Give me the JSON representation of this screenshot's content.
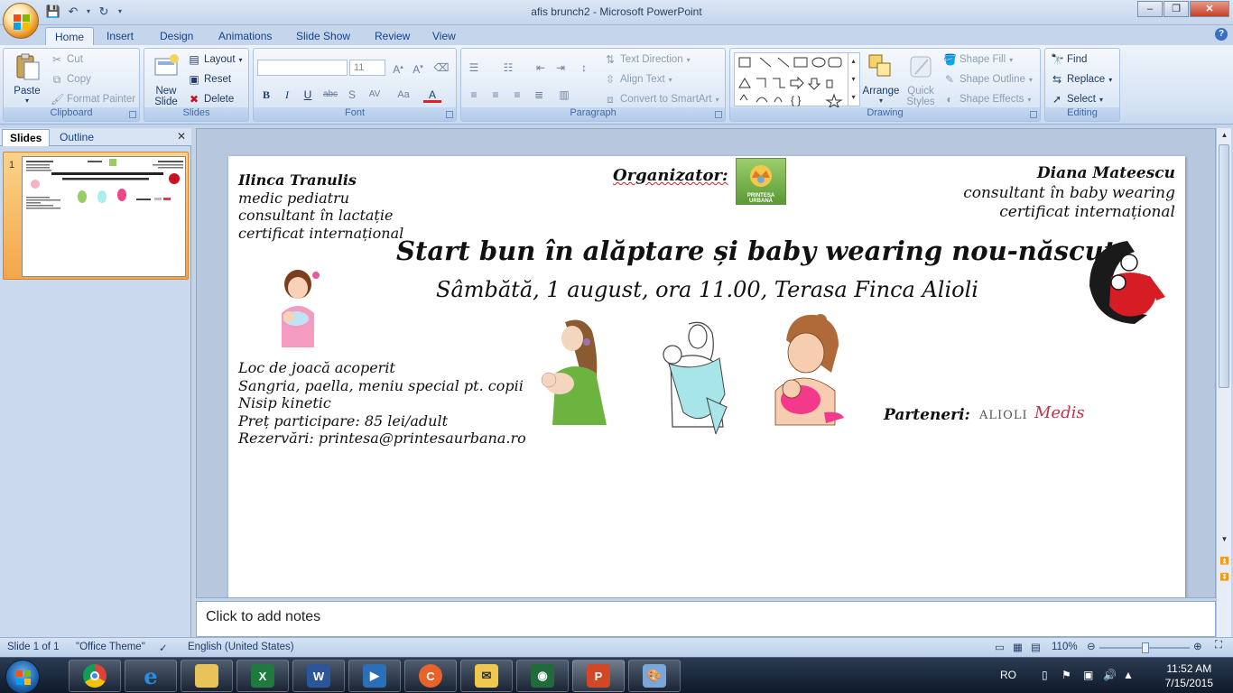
{
  "window": {
    "title": "afis brunch2 - Microsoft PowerPoint",
    "controls": [
      "minimize",
      "restore",
      "close"
    ]
  },
  "ribbon_tabs": [
    "Home",
    "Insert",
    "Design",
    "Animations",
    "Slide Show",
    "Review",
    "View"
  ],
  "ribbon": {
    "clipboard": {
      "label": "Clipboard",
      "paste": "Paste",
      "cut": "Cut",
      "copy": "Copy",
      "format_painter": "Format Painter"
    },
    "slides": {
      "label": "Slides",
      "new_slide": "New Slide",
      "layout": "Layout",
      "reset": "Reset",
      "delete": "Delete"
    },
    "font": {
      "label": "Font",
      "font_name": "",
      "font_size": "11"
    },
    "paragraph": {
      "label": "Paragraph",
      "text_direction": "Text Direction",
      "align_text": "Align Text",
      "convert_smartart": "Convert to SmartArt"
    },
    "drawing": {
      "label": "Drawing",
      "arrange": "Arrange",
      "quick_styles": "Quick Styles",
      "shape_fill": "Shape Fill",
      "shape_outline": "Shape Outline",
      "shape_effects": "Shape Effects"
    },
    "editing": {
      "label": "Editing",
      "find": "Find",
      "replace": "Replace",
      "select": "Select"
    }
  },
  "panel": {
    "tabs": [
      "Slides",
      "Outline"
    ],
    "slide_number": "1"
  },
  "slide": {
    "left_name": "Ilinca Tranulis",
    "left_lines": [
      "medic pediatru",
      "consultant în lactație",
      "certificat internațional"
    ],
    "organizer_label": "Organizator:",
    "organizer_logo_text": "PRINTESA URBANĂ",
    "right_name": "Diana Mateescu",
    "right_lines": [
      "consultant în baby wearing",
      "certificat internațional"
    ],
    "headline": "Start bun în alăptare și baby wearing nou-născut",
    "subheadline": "Sâmbătă, 1 august, ora 11.00, Terasa Finca Alioli",
    "details": [
      "Loc de joacă acoperit",
      "Sangria, paella, meniu special pt. copii",
      "Nisip kinetic",
      "Preț participare:  85 lei/adult",
      "Rezervări: printesa@printesaurbana.ro"
    ],
    "partners_label": "Parteneri:",
    "partner_logos": [
      "ALIOLI",
      "Medis"
    ]
  },
  "notes_placeholder": "Click to add notes",
  "status": {
    "slide_count": "Slide 1 of 1",
    "theme": "\"Office Theme\"",
    "language": "English (United States)",
    "zoom": "110%"
  },
  "taskbar": {
    "apps": [
      "chrome",
      "internet-explorer",
      "file-explorer",
      "excel",
      "word",
      "media-player",
      "app-orange",
      "outlook",
      "app-eye",
      "powerpoint",
      "paint"
    ],
    "language": "RO",
    "time": "11:52 AM",
    "date": "7/15/2015"
  },
  "colors": {
    "ribbon_bg": "#dbe6f4",
    "accent_orange": "#f3a64a",
    "close_red": "#c4402a",
    "taskbar": "#1a283c"
  }
}
